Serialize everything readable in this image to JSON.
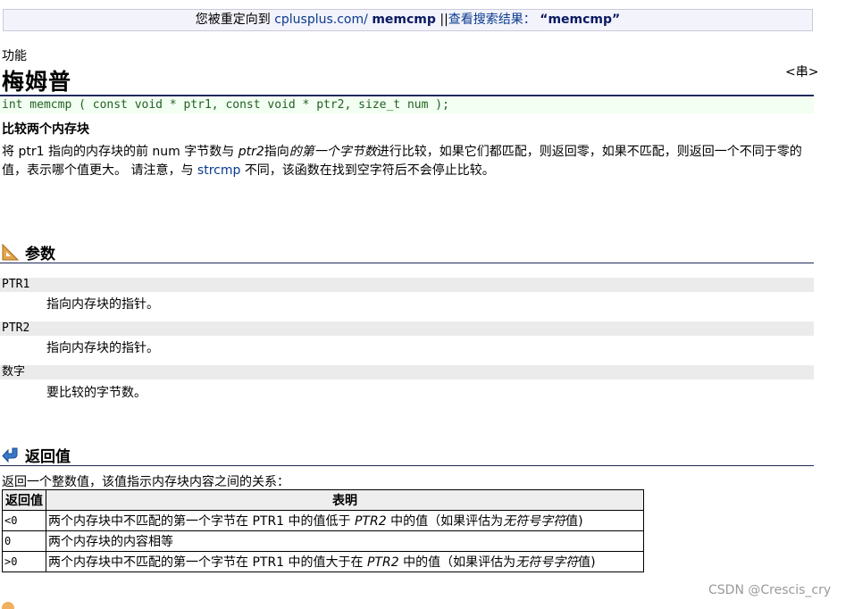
{
  "redirect": {
    "prefix": "您被重定向到",
    "site": "cplusplus.com/",
    "target": "memcmp",
    "separator": "||",
    "search_label": "查看搜索结果：",
    "query": "“memcmp”"
  },
  "page": {
    "category": "功能",
    "title": "梅姆普",
    "header_tag": "<串>",
    "prototype": "int memcmp ( const void * ptr1, const void * ptr2, size_t num );",
    "short_desc": "比较两个内存块",
    "desc": {
      "p1": "将 ptr1 指向的内存块的前 num 字节数与",
      "p1_ptr2": "ptr2",
      "p1_b": "指向",
      "p1_italic": "的第一个字节数",
      "p1_c": "进行比较，如果它们都匹配，则返回零，如果不匹配，则返回一个不同于零的值，表示哪个值更大。 请注意，与",
      "strcmp": "strcmp",
      "p1_d": "不同，该函数在找到空字符后不会停止比较。"
    }
  },
  "params": {
    "heading": "参数",
    "items": [
      {
        "name": "PTR1",
        "desc": "指向内存块的指针。"
      },
      {
        "name": "PTR2",
        "desc": "指向内存块的指针。"
      },
      {
        "name": "数字",
        "desc": "要比较的字节数。"
      }
    ]
  },
  "return": {
    "heading": "返回值",
    "intro": "返回一个整数值，该值指示内存块内容之间的关系：",
    "col_value": "返回值",
    "col_meaning": "表明",
    "rows": [
      {
        "value": "<0",
        "a": "两个内存块中不匹配的第一个字节在 PTR1 中的值低于",
        "ptr2": "PTR2",
        "b": "中的值（如果评估为",
        "unsigned": "无符号字符",
        "c": "值)"
      },
      {
        "value": "0",
        "a": "两个内存块的内容相等",
        "ptr2": "",
        "b": "",
        "unsigned": "",
        "c": ""
      },
      {
        "value": ">0",
        "a": "两个内存块中不匹配的第一个字节在 PTR1 中的值大于在",
        "ptr2": "PTR2",
        "b": "中的值（如果评估为",
        "unsigned": "无符号字符",
        "c": "值)"
      }
    ]
  },
  "watermark": "CSDN @Crescis_cry",
  "colors": {
    "rule": "#1e2a5a",
    "link": "#0a3a8c",
    "prototype_bg": "#f2fff2",
    "param_bg": "#ebebeb"
  }
}
